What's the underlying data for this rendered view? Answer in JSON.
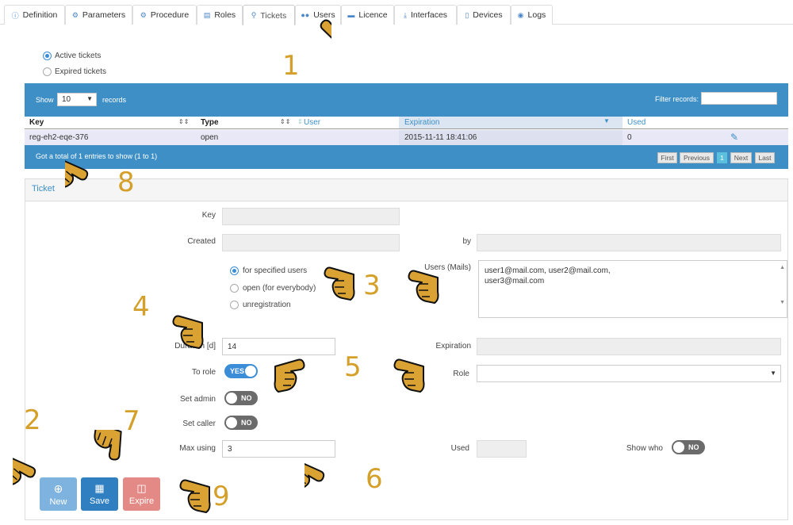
{
  "tabs": [
    {
      "label": "Definition",
      "icon": "info-icon"
    },
    {
      "label": "Parameters",
      "icon": "gear-icon"
    },
    {
      "label": "Procedure",
      "icon": "gears-icon"
    },
    {
      "label": "Roles",
      "icon": "stack-icon"
    },
    {
      "label": "Tickets",
      "icon": "key-icon"
    },
    {
      "label": "Users",
      "icon": "users-icon"
    },
    {
      "label": "Licence",
      "icon": "card-icon"
    },
    {
      "label": "Interfaces",
      "icon": "download-icon"
    },
    {
      "label": "Devices",
      "icon": "device-icon"
    },
    {
      "label": "Logs",
      "icon": "eye-icon"
    }
  ],
  "ticket_filter": {
    "active": "Active tickets",
    "expired": "Expired tickets"
  },
  "table": {
    "show_label": "Show",
    "show_value": "10",
    "records_label": "records",
    "filter_label": "Filter records:",
    "columns": {
      "key": "Key",
      "type": "Type",
      "user": "User",
      "expiration": "Expiration",
      "used": "Used"
    },
    "rows": [
      {
        "key": "reg-eh2-eqe-376",
        "type": "open",
        "user": "",
        "expiration": "2015-11-11 18:41:06",
        "used": "0"
      }
    ],
    "summary": "Got a total of 1 entries to show (1 to 1)",
    "pagination": {
      "first": "First",
      "previous": "Previous",
      "page": "1",
      "next": "Next",
      "last": "Last"
    }
  },
  "ticket": {
    "title": "Ticket",
    "key_label": "Key",
    "created_label": "Created",
    "by_label": "by",
    "radio_specified": "for specified users",
    "radio_open": "open (for everybody)",
    "radio_unreg": "unregistration",
    "users_label": "Users (Mails)",
    "users_value_1": "user1@mail.com, user2@mail.com,",
    "users_value_2": "user3@mail.com",
    "duration_label": "Duration [d]",
    "duration_value": "14",
    "expiration_label": "Expiration",
    "to_role_label": "To role",
    "to_role_toggle": "YES",
    "role_label": "Role",
    "set_admin_label": "Set admin",
    "set_admin_toggle": "NO",
    "set_caller_label": "Set caller",
    "set_caller_toggle": "NO",
    "max_using_label": "Max using",
    "max_using_value": "3",
    "used_label": "Used",
    "show_who_label": "Show who",
    "show_who_toggle": "NO"
  },
  "actions": {
    "new": "New",
    "save": "Save",
    "expire": "Expire"
  },
  "annotations": [
    "1",
    "2",
    "3",
    "4",
    "5",
    "6",
    "7",
    "8",
    "9"
  ],
  "colors": {
    "primary": "#3d8fc6",
    "new_btn": "#7fb3df",
    "save_btn": "#2f7fc1",
    "expire_btn": "#e38a86",
    "annotation": "#d4a02a",
    "hand": "#d9a232"
  }
}
